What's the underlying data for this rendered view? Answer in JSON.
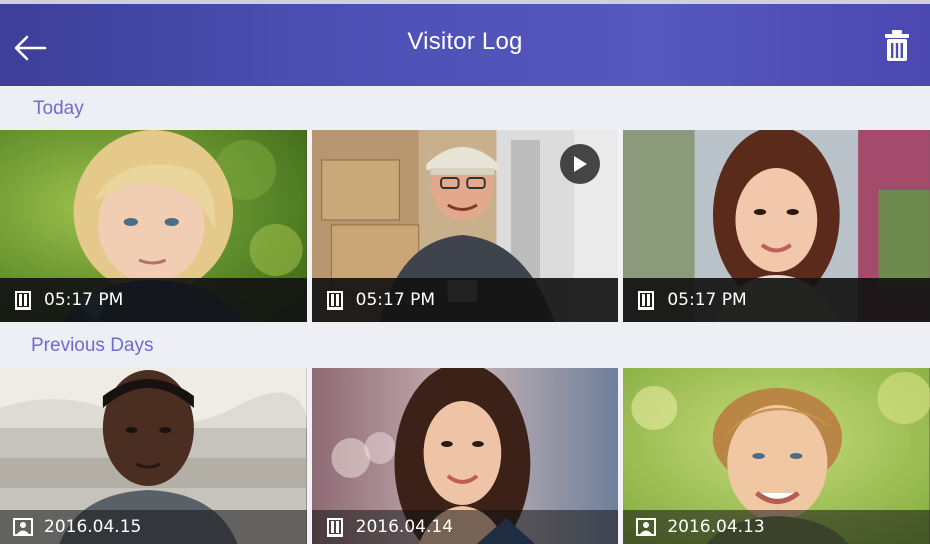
{
  "header": {
    "title": "Visitor Log",
    "back_icon": "arrow-left-icon",
    "delete_icon": "trash-icon"
  },
  "sections": {
    "today_label": "Today",
    "previous_label": "Previous Days"
  },
  "today": [
    {
      "time": "05:17 PM",
      "icon": "door-icon",
      "subject": "young girl with blonde hair"
    },
    {
      "time": "05:17 PM",
      "icon": "door-icon",
      "subject": "delivery man with cap",
      "has_video": true
    },
    {
      "time": "05:17 PM",
      "icon": "door-icon",
      "subject": "smiling woman"
    }
  ],
  "previous": [
    {
      "date": "2016.04.15",
      "icon": "photo-icon",
      "subject": "young man"
    },
    {
      "date": "2016.04.14",
      "icon": "door-icon",
      "subject": "smiling brunette woman"
    },
    {
      "date": "2016.04.13",
      "icon": "photo-icon",
      "subject": "smiling boy"
    }
  ],
  "colors": {
    "header_start": "#3d3f99",
    "header_end": "#5658c0",
    "section_text": "#6c6dd1",
    "section_bg": "#eeeef5"
  }
}
